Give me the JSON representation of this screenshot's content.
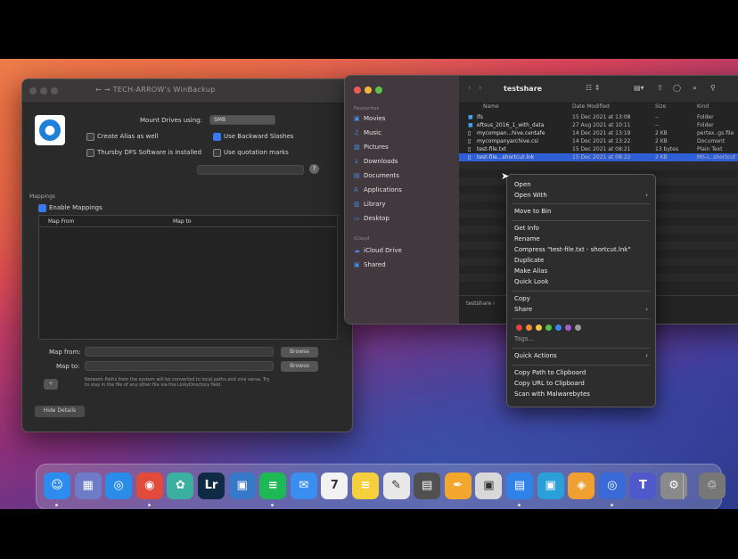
{
  "prefs": {
    "title": "← →  TECH-ARROW's WinBackup",
    "mount_label": "Mount Drives using:",
    "mount_value": "SMB",
    "create_alias": "Create Alias as well",
    "use_backward_slashes": "Use Backward Slashes",
    "thursby": "Thursby DFS Software is installed",
    "use_quotation": "Use quotation marks",
    "mappings_section": "Mappings",
    "enable_mappings": "Enable Mappings",
    "col_map_from": "Map From",
    "col_map_to": "Map to",
    "map_from_label": "Map from:",
    "map_to_label": "Map to:",
    "note": "Network Paths from the system will be converted to local paths and vice versa. Try to stay in the file of any other file via the LinkyDirectory field.",
    "hide_details": "Hide Details",
    "add_btn": "+",
    "browse_btn": "Browse"
  },
  "finder": {
    "title": "testshare",
    "sidebar": [
      {
        "label": "Movies",
        "icon": "movies-icon",
        "glyph": "▣"
      },
      {
        "label": "Music",
        "icon": "music-icon",
        "glyph": "♫"
      },
      {
        "label": "Pictures",
        "icon": "pictures-icon",
        "glyph": "▧"
      },
      {
        "label": "Downloads",
        "icon": "downloads-icon",
        "glyph": "↓"
      },
      {
        "label": "Documents",
        "icon": "documents-icon",
        "glyph": "▤"
      },
      {
        "label": "Applications",
        "icon": "applications-icon",
        "glyph": "A"
      },
      {
        "label": "Library",
        "icon": "library-icon",
        "glyph": "▥"
      },
      {
        "label": "Desktop",
        "icon": "desktop-icon",
        "glyph": "▭"
      }
    ],
    "sidebar_section_icloud": "iCloud",
    "sidebar_more": [
      {
        "label": "iCloud Drive",
        "icon": "cloud-icon",
        "glyph": "☁"
      },
      {
        "label": "Shared",
        "icon": "shared-icon",
        "glyph": "▣"
      }
    ],
    "columns": {
      "name": "Name",
      "date": "Date Modified",
      "size": "Size",
      "kind": "Kind"
    },
    "rows": [
      {
        "name": "ifs",
        "date": "15 Dec 2021 at 13:08",
        "size": "--",
        "kind": "Folder"
      },
      {
        "name": "eftsus_2016_1_with_data",
        "date": "27 Aug 2021 at 10:11",
        "size": "--",
        "kind": "Folder"
      },
      {
        "name": "mycompan...hive.centafe",
        "date": "14 Dec 2021 at 13:19",
        "size": "2 KB",
        "kind": "pertex..gs file"
      },
      {
        "name": "mycompanyarchive.csi",
        "date": "14 Dec 2021 at 13:22",
        "size": "2 KB",
        "kind": "Document"
      },
      {
        "name": "test-file.txt",
        "date": "15 Dec 2021 at 08:21",
        "size": "13 bytes",
        "kind": "Plain Text"
      },
      {
        "name": "test-file...shortcut.lnk",
        "date": "15 Dec 2021 at 08:22",
        "size": "2 KB",
        "kind": "MS-L..shortcut"
      }
    ],
    "path_bar": "testshare ›"
  },
  "context_menu": {
    "open": "Open",
    "open_with": "Open With",
    "move_to_bin": "Move to Bin",
    "get_info": "Get Info",
    "rename": "Rename",
    "compress": "Compress \"test-file.txt - shortcut.lnk\"",
    "duplicate": "Duplicate",
    "make_alias": "Make Alias",
    "quick_look": "Quick Look",
    "copy": "Copy",
    "share": "Share",
    "tags": "Tags...",
    "quick_actions": "Quick Actions",
    "copy_path": "Copy Path to Clipboard",
    "copy_url": "Copy URL to Clipboard",
    "scan": "Scan with Malwarebytes",
    "tag_colors": [
      "#e0443f",
      "#f08a2c",
      "#f2c83a",
      "#52c04a",
      "#3a84f0",
      "#a35bd6",
      "#9a9a9a"
    ]
  },
  "dock": {
    "apps": [
      {
        "name": "finder",
        "glyph": "☺",
        "color": "#2d8cf0"
      },
      {
        "name": "launchpad",
        "glyph": "▦",
        "color": "#6e7cc8"
      },
      {
        "name": "safari",
        "glyph": "◎",
        "color": "#2a8ce8"
      },
      {
        "name": "chrome",
        "glyph": "◉",
        "color": "#e24a3b"
      },
      {
        "name": "photos-app",
        "glyph": "✿",
        "color": "#3bb0a0"
      },
      {
        "name": "lightroom",
        "glyph": "Lr",
        "color": "#0f2a45"
      },
      {
        "name": "preview",
        "glyph": "▣",
        "color": "#3778c8"
      },
      {
        "name": "spotify",
        "glyph": "≡",
        "color": "#1db954"
      },
      {
        "name": "mail",
        "glyph": "✉",
        "color": "#3a8ef0"
      },
      {
        "name": "calendar",
        "glyph": "7",
        "color": "#f2f2f2"
      },
      {
        "name": "notes",
        "glyph": "≡",
        "color": "#f5cf3c"
      },
      {
        "name": "textedit",
        "glyph": "✎",
        "color": "#e8e8e8"
      },
      {
        "name": "calculator",
        "glyph": "▤",
        "color": "#505050"
      },
      {
        "name": "pages",
        "glyph": "✒",
        "color": "#f3a82d"
      },
      {
        "name": "screenshot",
        "glyph": "▣",
        "color": "#d8d8d8"
      },
      {
        "name": "keynote",
        "glyph": "▤",
        "color": "#2f82e8"
      },
      {
        "name": "preview-2",
        "glyph": "▣",
        "color": "#2a9fd8"
      },
      {
        "name": "vpn",
        "glyph": "◈",
        "color": "#f0a030"
      },
      {
        "name": "system-info",
        "glyph": "◎",
        "color": "#3a6ad8"
      },
      {
        "name": "teams",
        "glyph": "T",
        "color": "#5059c9"
      },
      {
        "name": "system-preferences",
        "glyph": "⚙",
        "color": "#8a8a8a"
      },
      {
        "name": "trash",
        "glyph": "♲",
        "color": "#777"
      }
    ]
  }
}
